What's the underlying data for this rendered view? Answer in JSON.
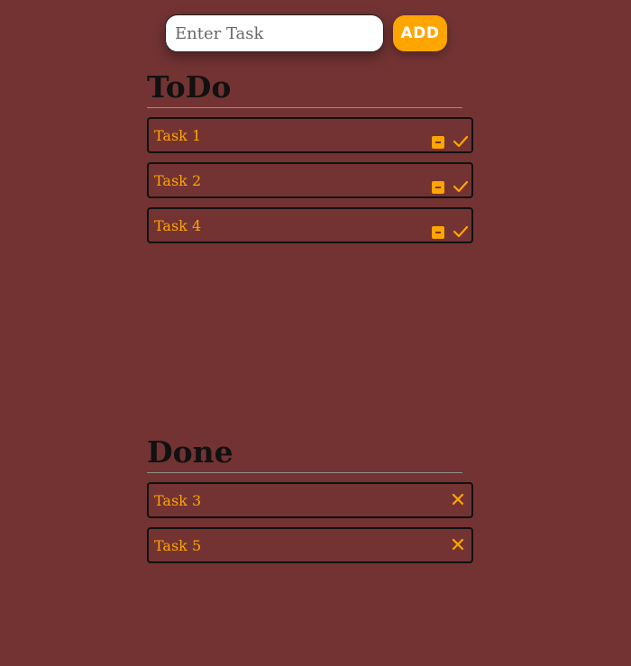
{
  "input": {
    "placeholder": "Enter Task",
    "value": ""
  },
  "add_button": {
    "label": "ADD"
  },
  "todo": {
    "title": "ToDo",
    "items": [
      {
        "label": "Task 1"
      },
      {
        "label": "Task 2"
      },
      {
        "label": "Task 4"
      }
    ]
  },
  "done": {
    "title": "Done",
    "items": [
      {
        "label": "Task 3"
      },
      {
        "label": "Task 5"
      }
    ]
  },
  "icons": {
    "remove": "minus-square-icon",
    "complete": "checkmark-icon",
    "delete": "close-icon"
  },
  "colors": {
    "background": "#733333",
    "accent": "#ffa500",
    "input_bg": "#ffffff",
    "heading": "#111111"
  }
}
